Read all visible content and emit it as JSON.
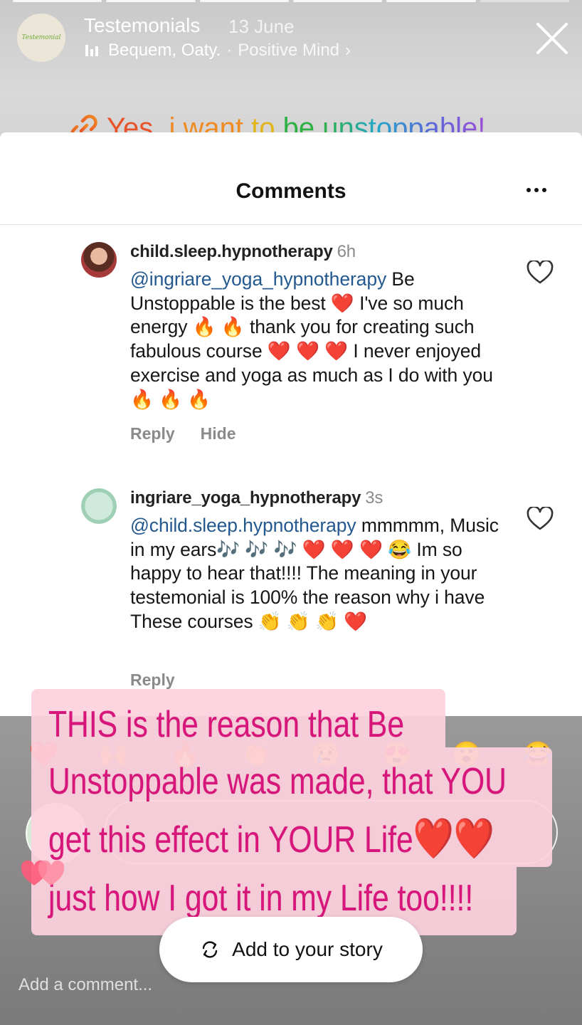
{
  "story_header": {
    "avatar_text": "Testemonial",
    "title": "Testemonials",
    "date": "13 June",
    "music_artist": "Bequem, Oaty.",
    "music_separator": "·",
    "music_track": "Positive Mind",
    "music_chevron": "›"
  },
  "link_sticker": {
    "words": [
      "Yes,",
      "i",
      "want",
      "to",
      "be",
      "unstoppable!"
    ],
    "icon": "link-icon"
  },
  "comments_panel": {
    "title": "Comments",
    "comments": [
      {
        "user": "child.sleep.hypnotherapy",
        "time": "6h",
        "mention": "@ingriare_yoga_hypnotherapy",
        "text": " Be Unstoppable is the best ❤️ I've so much energy 🔥 🔥 thank you for creating such fabulous course ❤️ ❤️ ❤️ I never enjoyed exercise and yoga as much as I do with you 🔥 🔥 🔥",
        "reply": "Reply",
        "hide": "Hide"
      },
      {
        "user": "ingriare_yoga_hypnotherapy",
        "time": "3s",
        "mention": "@child.sleep.hypnotherapy",
        "text": " mmmmm, Music in my ears🎶 🎶 🎶 ❤️ ❤️ ❤️ 😂 Im so happy to hear that!!!! The meaning in your testemonial is 100% the reason why i have These courses 👏 👏 👏 ❤️",
        "reply": "Reply"
      }
    ]
  },
  "reactions": [
    "❤️",
    "🙌",
    "🔥",
    "👏",
    "😢",
    "😍",
    "😮",
    "😂"
  ],
  "text_sticker": {
    "line1": "THIS is the reason that Be",
    "line2": "Unstoppable was made, that YOU",
    "line3": "get this effect in YOUR Life",
    "line3_hearts": "❤️❤️",
    "line4": "just how I got it in my Life too!!!!"
  },
  "add_story": {
    "label": "Add to your story"
  },
  "comment_input": {
    "placeholder": "Add a comment..."
  },
  "colors": {
    "sticker_text": "#d6167a",
    "sticker_bg": "#fcd2de",
    "mention": "#23598f"
  }
}
